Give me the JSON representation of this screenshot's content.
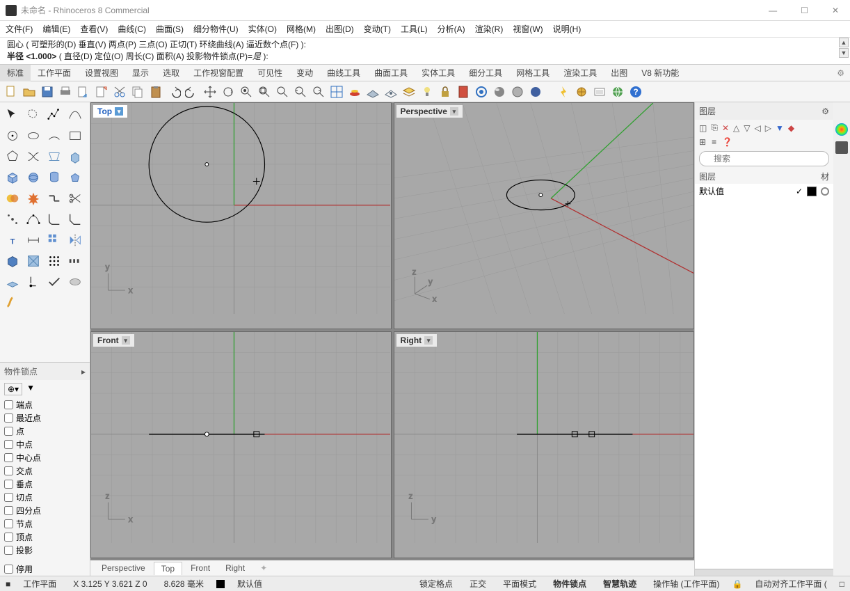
{
  "titlebar": {
    "title": "未命名 - Rhinoceros 8 Commercial"
  },
  "menubar": [
    "文件(F)",
    "编辑(E)",
    "查看(V)",
    "曲线(C)",
    "曲面(S)",
    "细分物件(U)",
    "实体(O)",
    "网格(M)",
    "出图(D)",
    "变动(T)",
    "工具(L)",
    "分析(A)",
    "渲染(R)",
    "视窗(W)",
    "说明(H)"
  ],
  "cmd": {
    "line1_prefix": "圆心 (",
    "line1_opts": " 可塑形的(D)  垂直(V)  两点(P)  三点(O)  正切(T)  环绕曲线(A)  逼近数个点(F) ",
    "line1_suffix": "):",
    "line2_prefix": "半径 ",
    "line2_val": "<1.000>",
    "line2_opts": " ( 直径(D)  定位(O)  周长(C)  面积(A)  投影物件锁点(P)=",
    "line2_italic": "是",
    "line2_suffix": " ):"
  },
  "tabs": [
    "标准",
    "工作平面",
    "设置视图",
    "显示",
    "选取",
    "工作视窗配置",
    "可见性",
    "变动",
    "曲线工具",
    "曲面工具",
    "实体工具",
    "细分工具",
    "网格工具",
    "渲染工具",
    "出图",
    "V8 新功能"
  ],
  "viewports": {
    "top": "Top",
    "perspective": "Perspective",
    "front": "Front",
    "right": "Right"
  },
  "vptabs": [
    "Perspective",
    "Top",
    "Front",
    "Right"
  ],
  "osnap": {
    "title": "物件锁点",
    "items": [
      "端点",
      "最近点",
      "点",
      "中点",
      "中心点",
      "交点",
      "垂点",
      "切点",
      "四分点",
      "节点",
      "顶点",
      "投影"
    ],
    "disable": "停用"
  },
  "layers": {
    "title": "图层",
    "search_ph": "搜索",
    "col1": "图层",
    "col2": "材",
    "default": "默认值"
  },
  "status": {
    "cplane": "工作平面",
    "coords": "X 3.125 Y 3.621 Z 0",
    "dist": "8.628 毫米",
    "layer": "默认值",
    "snap": "锁定格点",
    "ortho": "正交",
    "planar": "平面模式",
    "osnap": "物件锁点",
    "smart": "智慧轨迹",
    "gumball": "操作轴 (工作平面)",
    "autoalign": "自动对齐工作平面 (",
    "record": "□"
  }
}
